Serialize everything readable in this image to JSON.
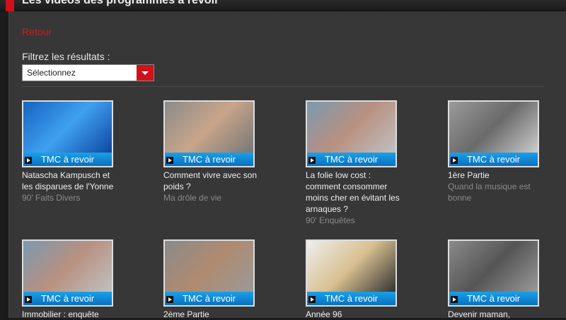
{
  "header": {
    "title": "Les vidéos des programmes à revoir"
  },
  "retour": "Retour",
  "filter": {
    "label": "Filtrez les résultats :",
    "selected": "Sélectionnez"
  },
  "band_label": "TMC à revoir",
  "videos": [
    {
      "title": "Natascha Kampusch et les disparues de l'Yonne",
      "program": "90' Faits Divers",
      "bg": "linear-gradient(135deg,#1565c0,#40a0f0,#0d47a1)"
    },
    {
      "title": "Comment vivre avec son poids ?",
      "program": "Ma drôle de vie",
      "bg": "linear-gradient(135deg,#8a8a8a,#c9a58a,#777)"
    },
    {
      "title": "La folie low cost : comment consommer moins cher en évitant les arnaques ?",
      "program": "90' Enquêtes",
      "bg": "linear-gradient(135deg,#7a9ab0,#b89080,#c0c0c0)"
    },
    {
      "title": "1ère Partie",
      "program": "Quand la musique est bonne",
      "bg": "linear-gradient(135deg,#9a9a9a,#6a6a6a,#ccc)"
    },
    {
      "title": "Immobilier : enquête",
      "program": "",
      "bg": "linear-gradient(135deg,#7a9ab0,#b89080,#c0c0c0)"
    },
    {
      "title": "2ème Partie",
      "program": "",
      "bg": "linear-gradient(135deg,#8a8a8a,#b08a70,#999)"
    },
    {
      "title": "Année 96",
      "program": "",
      "bg": "linear-gradient(135deg,#eee,#d8c090,#333)"
    },
    {
      "title": "Devenir maman,",
      "program": "",
      "bg": "linear-gradient(135deg,#8a8a8a,#555,#999)"
    }
  ]
}
